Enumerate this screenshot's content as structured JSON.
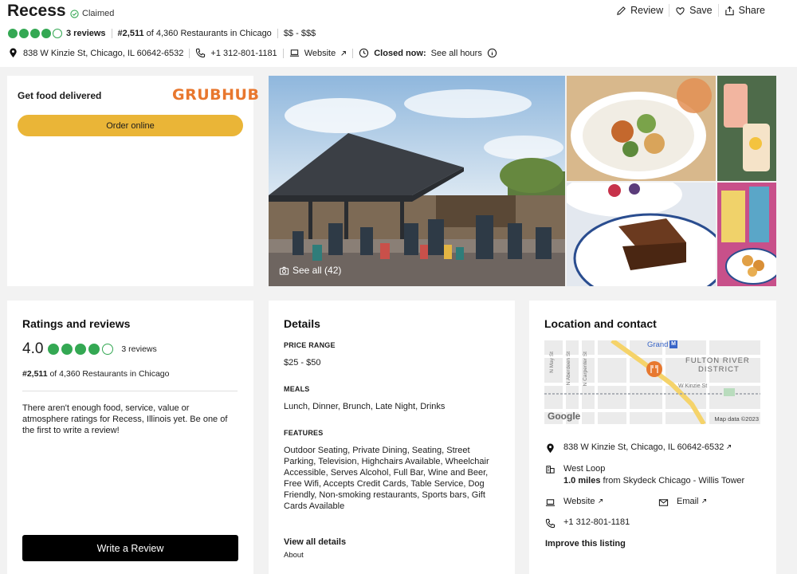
{
  "header": {
    "title": "Recess",
    "claimed": "Claimed",
    "actions": {
      "review": "Review",
      "save": "Save",
      "share": "Share"
    },
    "rating_bubbles": 4,
    "reviews_count": "3 reviews",
    "rank_bold": "#2,511",
    "rank_rest": " of 4,360 Restaurants in Chicago",
    "price": "$$ - $$$",
    "address": "838 W Kinzie St, Chicago, IL 60642-6532",
    "phone": "+1 312-801-1181",
    "website": "Website",
    "closed_now": "Closed now:",
    "see_hours": "See all hours"
  },
  "delivery": {
    "label": "Get food delivered",
    "brand": "GRUBHUB",
    "order": "Order online"
  },
  "photos": {
    "see_all": "See all (42)"
  },
  "ratings": {
    "heading": "Ratings and reviews",
    "score": "4.0",
    "reviews": "3 reviews",
    "rank_bold": "#2,511",
    "rank_rest": " of 4,360 Restaurants in Chicago",
    "note": "There aren't enough food, service, value or atmosphere ratings for Recess, Illinois yet. Be one of the first to write a review!",
    "write": "Write a Review"
  },
  "details": {
    "heading": "Details",
    "price_label": "PRICE RANGE",
    "price_value": "$25 - $50",
    "meals_label": "MEALS",
    "meals_value": "Lunch, Dinner, Brunch, Late Night, Drinks",
    "features_label": "FEATURES",
    "features_value": "Outdoor Seating, Private Dining, Seating, Street Parking, Television, Highchairs Available, Wheelchair Accessible, Serves Alcohol, Full Bar, Wine and Beer, Free Wifi, Accepts Credit Cards, Table Service, Dog Friendly, Non-smoking restaurants, Sports bars, Gift Cards Available",
    "view_all": "View all details",
    "about": "About"
  },
  "location": {
    "heading": "Location and contact",
    "map": {
      "grand": "Grand",
      "district_line1": "FULTON RIVER",
      "district_line2": "DISTRICT",
      "street_kinzie": "W Kinzie St",
      "street_may": "N May St",
      "street_aberdeen": "N Aberdeen St",
      "street_carpenter": "N Carpenter St",
      "google": "Google",
      "map_data": "Map data ©2023"
    },
    "address": "838 W Kinzie St, Chicago, IL 60642-6532",
    "neighborhood": "West Loop",
    "distance_bold": "1.0 miles",
    "distance_rest": " from Skydeck Chicago - Willis Tower",
    "website": "Website",
    "email": "Email",
    "phone": "+1 312-801-1181",
    "improve": "Improve this listing"
  },
  "colors": {
    "bubble": "#34a853",
    "order_button": "#eab537",
    "grubhub": "#e8772e"
  }
}
